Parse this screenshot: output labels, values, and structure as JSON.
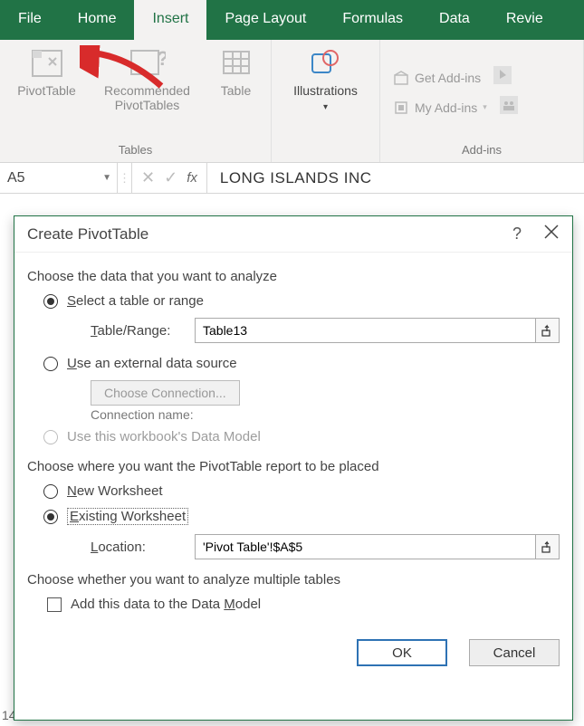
{
  "ribbon": {
    "tabs": {
      "file": "File",
      "home": "Home",
      "insert": "Insert",
      "page_layout": "Page Layout",
      "formulas": "Formulas",
      "data": "Data",
      "review": "Revie"
    },
    "groups": {
      "tables_label": "Tables",
      "addins_label": "Add-ins"
    },
    "buttons": {
      "pivottable": "PivotTable",
      "recommended_line1": "Recommended",
      "recommended_line2": "PivotTables",
      "table": "Table",
      "illustrations": "Illustrations",
      "get_addins": "Get Add-ins",
      "my_addins": "My Add-ins"
    }
  },
  "formula_bar": {
    "name_box": "A5",
    "fx_label": "fx",
    "value": "LONG ISLANDS INC"
  },
  "dialog": {
    "title": "Create PivotTable",
    "section1": "Choose the data that you want to analyze",
    "opt_select_pre": "S",
    "opt_select_post": "elect a table or range",
    "table_range_label_pre": "T",
    "table_range_label_post": "able/Range:",
    "table_range_value": "Table13",
    "opt_external_pre": "U",
    "opt_external_post": "se an external data source",
    "choose_connection": "Choose Connection...",
    "connection_name": "Connection name:",
    "opt_datamodel": "Use this workbook's Data Model",
    "section2": "Choose where you want the PivotTable report to be placed",
    "opt_newws_pre": "N",
    "opt_newws_post": "ew Worksheet",
    "opt_existws_pre": "E",
    "opt_existws_post": "xisting Worksheet",
    "location_label_pre": "L",
    "location_label_post": "ocation:",
    "location_value": "'Pivot Table'!$A$5",
    "section3": "Choose whether you want to analyze multiple tables",
    "chk_datamodel_pre": "Add this data to the Data ",
    "chk_datamodel_u": "M",
    "chk_datamodel_post": "odel",
    "ok": "OK",
    "cancel": "Cancel",
    "help": "?"
  },
  "sheet": {
    "row14": "14"
  }
}
